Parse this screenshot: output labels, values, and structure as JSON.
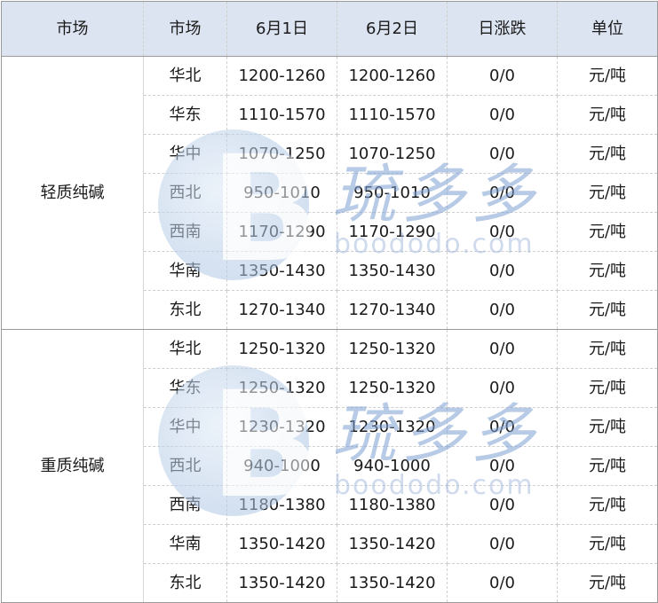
{
  "header": {
    "col0": "市场",
    "col1": "市场",
    "col2": "6月1日",
    "col3": "6月2日",
    "col4": "日涨跌",
    "col5": "单位"
  },
  "groups": [
    {
      "name": "轻质纯碱",
      "rows": [
        {
          "region": "华北",
          "d1": "1200-1260",
          "d2": "1200-1260",
          "change": "0/0",
          "unit": "元/吨"
        },
        {
          "region": "华东",
          "d1": "1110-1570",
          "d2": "1110-1570",
          "change": "0/0",
          "unit": "元/吨"
        },
        {
          "region": "华中",
          "d1": "1070-1250",
          "d2": "1070-1250",
          "change": "0/0",
          "unit": "元/吨"
        },
        {
          "region": "西北",
          "d1": "950-1010",
          "d2": "950-1010",
          "change": "0/0",
          "unit": "元/吨"
        },
        {
          "region": "西南",
          "d1": "1170-1290",
          "d2": "1170-1290",
          "change": "0/0",
          "unit": "元/吨"
        },
        {
          "region": "华南",
          "d1": "1350-1430",
          "d2": "1350-1430",
          "change": "0/0",
          "unit": "元/吨"
        },
        {
          "region": "东北",
          "d1": "1270-1340",
          "d2": "1270-1340",
          "change": "0/0",
          "unit": "元/吨"
        }
      ]
    },
    {
      "name": "重质纯碱",
      "rows": [
        {
          "region": "华北",
          "d1": "1250-1320",
          "d2": "1250-1320",
          "change": "0/0",
          "unit": "元/吨"
        },
        {
          "region": "华东",
          "d1": "1250-1320",
          "d2": "1250-1320",
          "change": "0/0",
          "unit": "元/吨"
        },
        {
          "region": "华中",
          "d1": "1230-1320",
          "d2": "1230-1320",
          "change": "0/0",
          "unit": "元/吨"
        },
        {
          "region": "西北",
          "d1": "940-1000",
          "d2": "940-1000",
          "change": "0/0",
          "unit": "元/吨"
        },
        {
          "region": "西南",
          "d1": "1180-1380",
          "d2": "1180-1380",
          "change": "0/0",
          "unit": "元/吨"
        },
        {
          "region": "华南",
          "d1": "1350-1420",
          "d2": "1350-1420",
          "change": "0/0",
          "unit": "元/吨"
        },
        {
          "region": "东北",
          "d1": "1350-1420",
          "d2": "1350-1420",
          "change": "0/0",
          "unit": "元/吨"
        }
      ]
    }
  ],
  "watermark": {
    "cn_text": "琉多多",
    "en_text": "boododo.com",
    "logo_letter": "B"
  }
}
